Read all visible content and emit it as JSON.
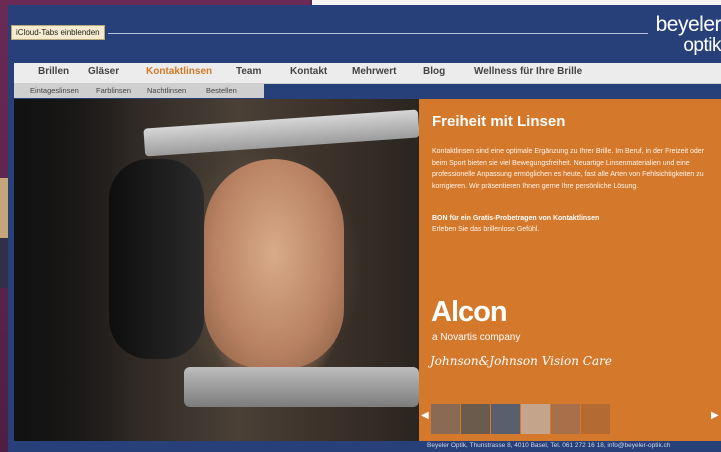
{
  "header": {
    "icloud_button": "iCloud-Tabs einblenden",
    "logo_line1": "beyeler",
    "logo_line2": "optik"
  },
  "nav": {
    "items": [
      {
        "label": "Brillen"
      },
      {
        "label": "Gläser"
      },
      {
        "label": "Kontaktlinsen",
        "active": true
      },
      {
        "label": "Team"
      },
      {
        "label": "Kontakt"
      },
      {
        "label": "Mehrwert"
      },
      {
        "label": "Blog"
      },
      {
        "label": "Wellness für Ihre Brille"
      }
    ],
    "active_color": "#d2792a"
  },
  "subnav": {
    "items": [
      {
        "label": "Eintageslinsen"
      },
      {
        "label": "Farblinsen"
      },
      {
        "label": "Nachtlinsen"
      },
      {
        "label": "Bestellen"
      }
    ]
  },
  "panel": {
    "title": "Freiheit mit Linsen",
    "body": "Kontaktlinsen sind eine optimale Ergänzung zu Ihrer Brille. Im Beruf, in der Freizeit oder beim Sport bieten sie viel Bewegungsfreiheit. Neuartige Linsenmaterialien und eine professionelle Anpassung ermöglichen es heute, fast alle Arten von Fehlsichtigkeiten zu korrigieren. Wir präsentieren Ihnen gerne Ihre persönliche Lösung.",
    "bon": "BON für ein Gratis-Probetragen von Kontaktlinsen",
    "sub": "Erleben Sie das brillenlose Gefühl.",
    "brand1": "Alcon",
    "brand1_sub": "a Novartis company",
    "brand2": "Johnson&Johnson Vision Care",
    "background": "#d4782b"
  },
  "gallery": {
    "prev_icon": "chevron-left-icon",
    "next_icon": "chevron-right-icon",
    "thumbnail_colors": [
      "#8a6a55",
      "#6b5b4d",
      "#5a5f6e",
      "#c4a48a",
      "#a8704a",
      "#b26b30"
    ]
  },
  "footer": {
    "text": "Beyeler Optik, Thunstrasse 8, 4010 Basel, Tel. 061 272 16 18, info@beyeler-optik.ch"
  }
}
